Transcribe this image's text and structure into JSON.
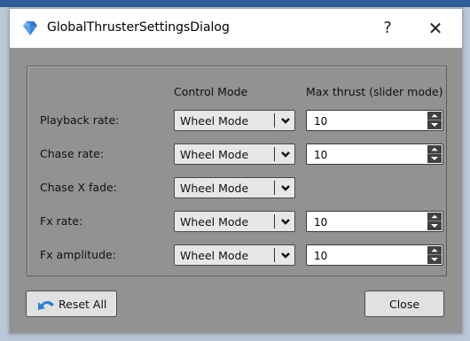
{
  "window": {
    "title": "GlobalThrusterSettingsDialog",
    "help_glyph": "?",
    "close_glyph": "✕"
  },
  "columns": {
    "control_mode": "Control Mode",
    "max_thrust": "Max thrust (slider mode)"
  },
  "rows": [
    {
      "label": "Playback rate:",
      "mode": "Wheel Mode",
      "thrust": "10"
    },
    {
      "label": "Chase rate:",
      "mode": "Wheel Mode",
      "thrust": "10"
    },
    {
      "label": "Chase X fade:",
      "mode": "Wheel Mode"
    },
    {
      "label": "Fx rate:",
      "mode": "Wheel Mode",
      "thrust": "10"
    },
    {
      "label": "Fx amplitude:",
      "mode": "Wheel Mode",
      "thrust": "10"
    }
  ],
  "buttons": {
    "reset_all": "Reset All",
    "close": "Close"
  },
  "icons": {
    "app": "diamond-gem-icon",
    "reset": "undo-arrow-icon",
    "dropdown": "chevron-down-icon",
    "spin_up": "triangle-up-icon",
    "spin_down": "triangle-down-icon"
  },
  "colors": {
    "dialog_background": "#929292",
    "app_icon": "#3f86d8"
  }
}
